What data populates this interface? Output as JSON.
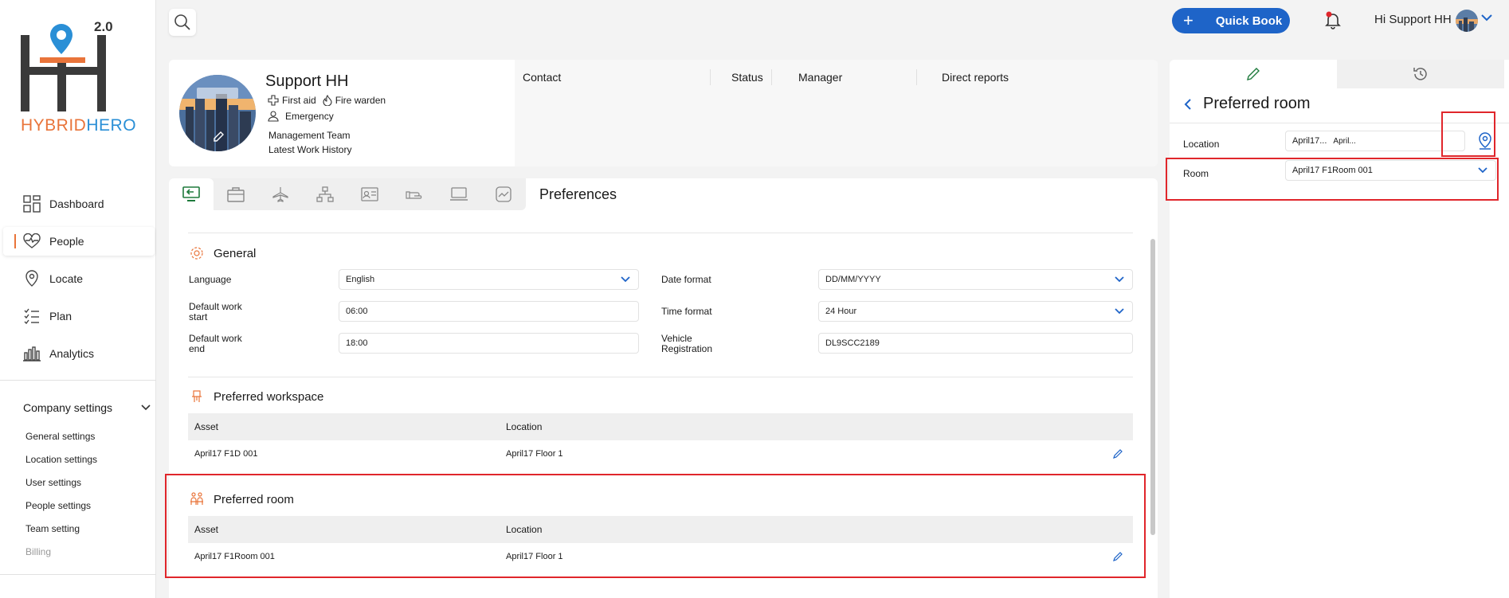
{
  "app": {
    "logo_version": "2.0",
    "logo_word_1": "HYBRID",
    "logo_word_2": "HERO"
  },
  "sidebar": {
    "items": [
      {
        "label": "Dashboard",
        "icon": "dashboard-icon"
      },
      {
        "label": "People",
        "icon": "heart-pulse-icon",
        "active": true
      },
      {
        "label": "Locate",
        "icon": "location-pin-icon"
      },
      {
        "label": "Plan",
        "icon": "checklist-icon"
      },
      {
        "label": "Analytics",
        "icon": "bar-chart-icon"
      }
    ],
    "company_settings": "Company settings",
    "sub_items": [
      {
        "label": "General settings"
      },
      {
        "label": "Location settings"
      },
      {
        "label": "User settings"
      },
      {
        "label": "People settings"
      },
      {
        "label": "Team setting"
      },
      {
        "label": "Billing",
        "muted": true
      }
    ]
  },
  "topbar": {
    "quick_book": "Quick Book",
    "greeting": "Hi Support HH"
  },
  "profile": {
    "name": "Support HH",
    "tag_first_aid": "First aid",
    "tag_fire_warden": "Fire warden",
    "emergency": "Emergency",
    "team": "Management Team",
    "history": "Latest Work History",
    "columns": [
      "Contact",
      "Status",
      "Manager",
      "Direct reports"
    ]
  },
  "preferences": {
    "title": "Preferences",
    "general": {
      "heading": "General",
      "language_label": "Language",
      "language_value": "English",
      "work_start_label": "Default work start",
      "work_start_value": "06:00",
      "work_end_label": "Default work end",
      "work_end_value": "18:00",
      "date_format_label": "Date format",
      "date_format_value": "DD/MM/YYYY",
      "time_format_label": "Time format",
      "time_format_value": "24 Hour",
      "vehicle_label": "Vehicle Registration",
      "vehicle_value": "DL9SCC2189"
    },
    "workspace": {
      "heading": "Preferred workspace",
      "col_asset": "Asset",
      "col_location": "Location",
      "row_asset": "April17 F1D 001",
      "row_location": "April17 Floor 1"
    },
    "room": {
      "heading": "Preferred room",
      "col_asset": "Asset",
      "col_location": "Location",
      "row_asset": "April17 F1Room 001",
      "row_location": "April17 Floor 1"
    }
  },
  "panel": {
    "title": "Preferred room",
    "location_label": "Location",
    "location_value_1": "April17...",
    "location_value_2": "April...",
    "room_label": "Room",
    "room_value": "April17 F1Room 001"
  },
  "colors": {
    "accent_blue": "#1e64c8",
    "accent_orange": "#e9743a",
    "highlight_red": "#e0262b"
  }
}
